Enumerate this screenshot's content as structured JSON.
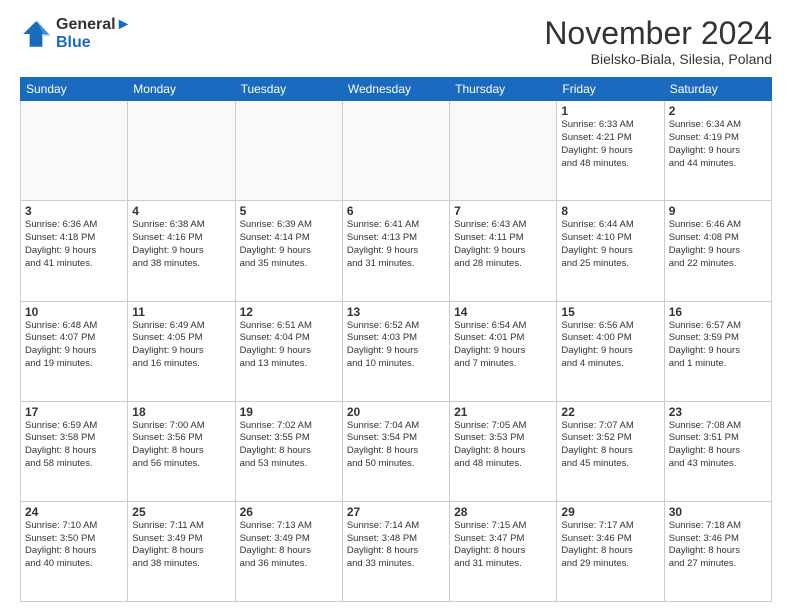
{
  "header": {
    "logo_line1": "General",
    "logo_line2": "Blue",
    "month_title": "November 2024",
    "location": "Bielsko-Biala, Silesia, Poland"
  },
  "days_of_week": [
    "Sunday",
    "Monday",
    "Tuesday",
    "Wednesday",
    "Thursday",
    "Friday",
    "Saturday"
  ],
  "weeks": [
    [
      {
        "day": "",
        "info": ""
      },
      {
        "day": "",
        "info": ""
      },
      {
        "day": "",
        "info": ""
      },
      {
        "day": "",
        "info": ""
      },
      {
        "day": "",
        "info": ""
      },
      {
        "day": "1",
        "info": "Sunrise: 6:33 AM\nSunset: 4:21 PM\nDaylight: 9 hours\nand 48 minutes."
      },
      {
        "day": "2",
        "info": "Sunrise: 6:34 AM\nSunset: 4:19 PM\nDaylight: 9 hours\nand 44 minutes."
      }
    ],
    [
      {
        "day": "3",
        "info": "Sunrise: 6:36 AM\nSunset: 4:18 PM\nDaylight: 9 hours\nand 41 minutes."
      },
      {
        "day": "4",
        "info": "Sunrise: 6:38 AM\nSunset: 4:16 PM\nDaylight: 9 hours\nand 38 minutes."
      },
      {
        "day": "5",
        "info": "Sunrise: 6:39 AM\nSunset: 4:14 PM\nDaylight: 9 hours\nand 35 minutes."
      },
      {
        "day": "6",
        "info": "Sunrise: 6:41 AM\nSunset: 4:13 PM\nDaylight: 9 hours\nand 31 minutes."
      },
      {
        "day": "7",
        "info": "Sunrise: 6:43 AM\nSunset: 4:11 PM\nDaylight: 9 hours\nand 28 minutes."
      },
      {
        "day": "8",
        "info": "Sunrise: 6:44 AM\nSunset: 4:10 PM\nDaylight: 9 hours\nand 25 minutes."
      },
      {
        "day": "9",
        "info": "Sunrise: 6:46 AM\nSunset: 4:08 PM\nDaylight: 9 hours\nand 22 minutes."
      }
    ],
    [
      {
        "day": "10",
        "info": "Sunrise: 6:48 AM\nSunset: 4:07 PM\nDaylight: 9 hours\nand 19 minutes."
      },
      {
        "day": "11",
        "info": "Sunrise: 6:49 AM\nSunset: 4:05 PM\nDaylight: 9 hours\nand 16 minutes."
      },
      {
        "day": "12",
        "info": "Sunrise: 6:51 AM\nSunset: 4:04 PM\nDaylight: 9 hours\nand 13 minutes."
      },
      {
        "day": "13",
        "info": "Sunrise: 6:52 AM\nSunset: 4:03 PM\nDaylight: 9 hours\nand 10 minutes."
      },
      {
        "day": "14",
        "info": "Sunrise: 6:54 AM\nSunset: 4:01 PM\nDaylight: 9 hours\nand 7 minutes."
      },
      {
        "day": "15",
        "info": "Sunrise: 6:56 AM\nSunset: 4:00 PM\nDaylight: 9 hours\nand 4 minutes."
      },
      {
        "day": "16",
        "info": "Sunrise: 6:57 AM\nSunset: 3:59 PM\nDaylight: 9 hours\nand 1 minute."
      }
    ],
    [
      {
        "day": "17",
        "info": "Sunrise: 6:59 AM\nSunset: 3:58 PM\nDaylight: 8 hours\nand 58 minutes."
      },
      {
        "day": "18",
        "info": "Sunrise: 7:00 AM\nSunset: 3:56 PM\nDaylight: 8 hours\nand 56 minutes."
      },
      {
        "day": "19",
        "info": "Sunrise: 7:02 AM\nSunset: 3:55 PM\nDaylight: 8 hours\nand 53 minutes."
      },
      {
        "day": "20",
        "info": "Sunrise: 7:04 AM\nSunset: 3:54 PM\nDaylight: 8 hours\nand 50 minutes."
      },
      {
        "day": "21",
        "info": "Sunrise: 7:05 AM\nSunset: 3:53 PM\nDaylight: 8 hours\nand 48 minutes."
      },
      {
        "day": "22",
        "info": "Sunrise: 7:07 AM\nSunset: 3:52 PM\nDaylight: 8 hours\nand 45 minutes."
      },
      {
        "day": "23",
        "info": "Sunrise: 7:08 AM\nSunset: 3:51 PM\nDaylight: 8 hours\nand 43 minutes."
      }
    ],
    [
      {
        "day": "24",
        "info": "Sunrise: 7:10 AM\nSunset: 3:50 PM\nDaylight: 8 hours\nand 40 minutes."
      },
      {
        "day": "25",
        "info": "Sunrise: 7:11 AM\nSunset: 3:49 PM\nDaylight: 8 hours\nand 38 minutes."
      },
      {
        "day": "26",
        "info": "Sunrise: 7:13 AM\nSunset: 3:49 PM\nDaylight: 8 hours\nand 36 minutes."
      },
      {
        "day": "27",
        "info": "Sunrise: 7:14 AM\nSunset: 3:48 PM\nDaylight: 8 hours\nand 33 minutes."
      },
      {
        "day": "28",
        "info": "Sunrise: 7:15 AM\nSunset: 3:47 PM\nDaylight: 8 hours\nand 31 minutes."
      },
      {
        "day": "29",
        "info": "Sunrise: 7:17 AM\nSunset: 3:46 PM\nDaylight: 8 hours\nand 29 minutes."
      },
      {
        "day": "30",
        "info": "Sunrise: 7:18 AM\nSunset: 3:46 PM\nDaylight: 8 hours\nand 27 minutes."
      }
    ]
  ]
}
